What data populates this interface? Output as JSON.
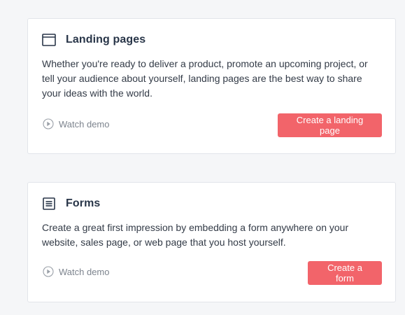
{
  "cards": [
    {
      "icon": "browser-window-icon",
      "title": "Landing pages",
      "description": "Whether you're ready to deliver a product, promote an upcoming project, or tell your audience about yourself, landing pages are the best way to share your ideas with the world.",
      "watch_label": "Watch demo",
      "button_label": "Create a landing page"
    },
    {
      "icon": "form-icon",
      "title": "Forms",
      "description": "Create a great first impression by embedding a form anywhere on your website, sales page, or web page that you host yourself.",
      "watch_label": "Watch demo",
      "button_label": "Create a form"
    }
  ],
  "colors": {
    "accent": "#f2646a",
    "background": "#f5f6f8",
    "card": "#ffffff",
    "title": "#283548",
    "muted": "#7d848e"
  }
}
